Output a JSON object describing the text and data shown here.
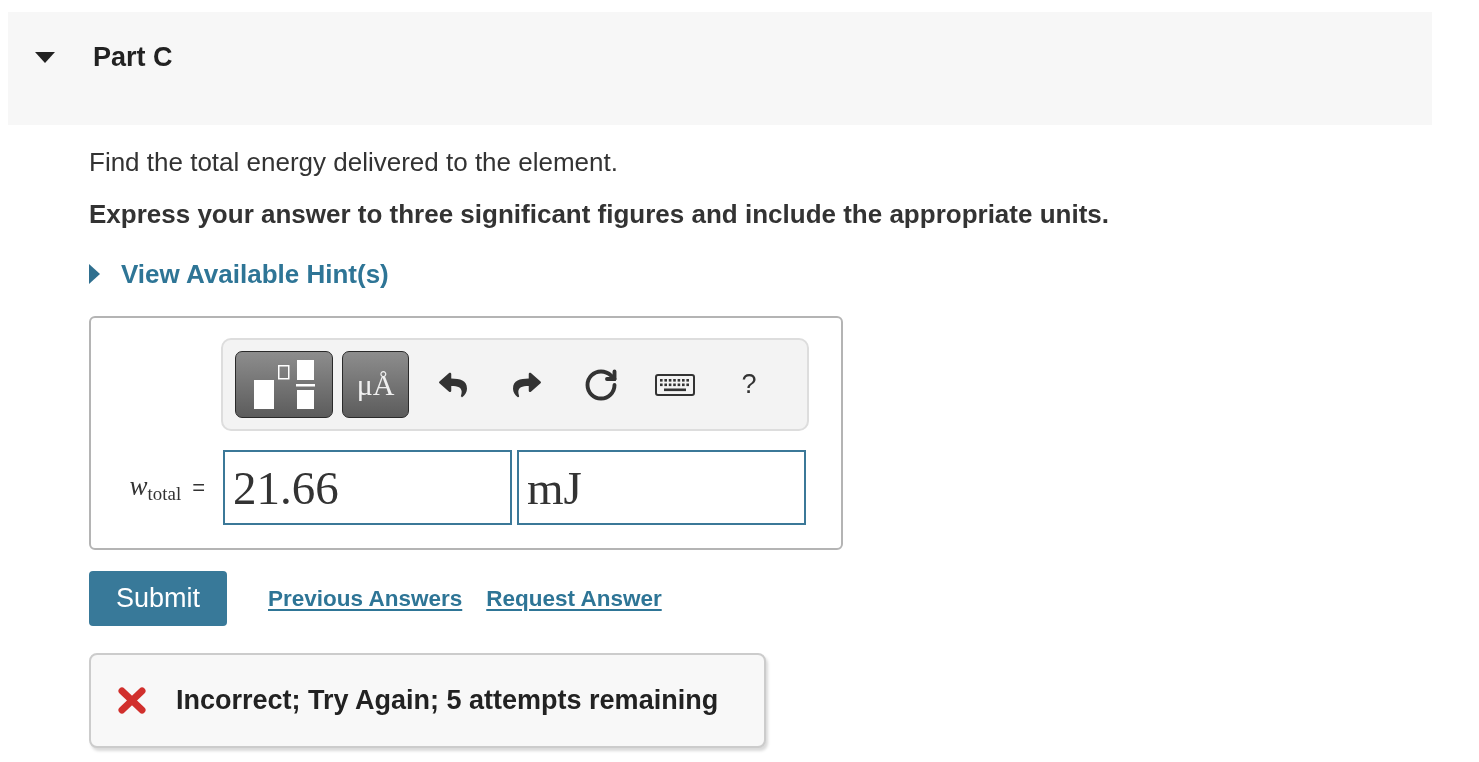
{
  "part": {
    "title": "Part C",
    "expanded": true
  },
  "question": {
    "prompt": "Find the total energy delivered to the element.",
    "instruction": "Express your answer to three significant figures and include the appropriate units."
  },
  "hints": {
    "label": "View Available Hint(s)",
    "expanded": false
  },
  "answer": {
    "toolbar": [
      {
        "kind": "templates"
      },
      {
        "kind": "symbols",
        "label": "μÅ"
      },
      {
        "kind": "undo"
      },
      {
        "kind": "redo"
      },
      {
        "kind": "reset"
      },
      {
        "kind": "keyboard"
      },
      {
        "kind": "help",
        "label": "?"
      }
    ],
    "variable": "*w*$_{total}$",
    "equals": "=",
    "value": "21.66",
    "unit": "mJ"
  },
  "actions": {
    "submit": "Submit",
    "links": [
      "Previous Answers",
      "Request Answer"
    ]
  },
  "feedback": {
    "correct": false,
    "message": "Incorrect; Try Again; 5 attempts remaining"
  }
}
